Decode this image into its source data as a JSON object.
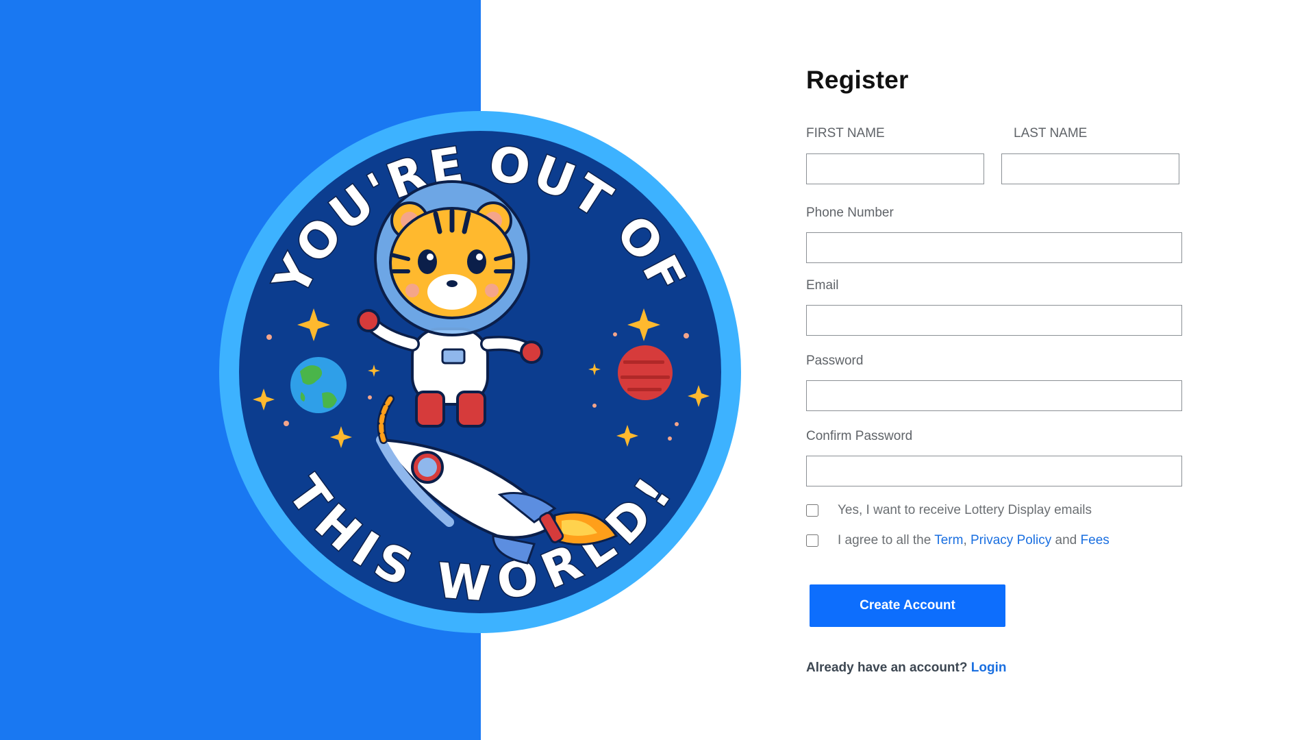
{
  "badge": {
    "text_top": "YOU'RE OUT OF",
    "text_bottom": "THIS WORLD!",
    "colors": {
      "ring": "#3db2ff",
      "inner": "#0c3d8f",
      "stars": "#ffb92e"
    }
  },
  "form": {
    "title": "Register",
    "first_name_label": "FIRST NAME",
    "last_name_label": "LAST NAME",
    "phone_label": "Phone Number",
    "email_label": "Email",
    "password_label": "Password",
    "confirm_password_label": "Confirm Password",
    "first_name_value": "",
    "last_name_value": "",
    "phone_value": "",
    "email_value": "",
    "password_value": "",
    "confirm_password_value": "",
    "emails_opt_in": "Yes, I want to receive Lottery Display emails",
    "agree_prefix": "I agree to all the",
    "term_link": "Term",
    "comma": ",",
    "privacy_link": "Privacy Policy",
    "and_text": "and",
    "fees_link": "Fees",
    "submit_label": "Create Account",
    "have_account": "Already have an account?",
    "login_link": "Login"
  },
  "colors": {
    "left_panel": "#1978f2",
    "primary_button": "#0d6efd",
    "link": "#1a6fe0"
  }
}
